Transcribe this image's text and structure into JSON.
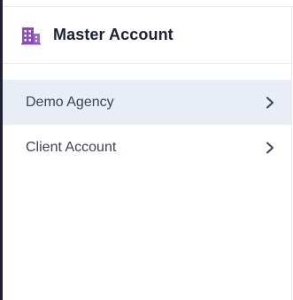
{
  "header": {
    "title": "Master Account",
    "icon": "building-icon",
    "icon_color": "#8b4bb8"
  },
  "menu": {
    "items": [
      {
        "label": "Demo Agency",
        "active": true,
        "icon": "chevron-right-icon"
      },
      {
        "label": "Client Account",
        "active": false,
        "icon": "chevron-right-icon"
      }
    ]
  },
  "colors": {
    "active_bg": "#e9eef6",
    "text": "#3d4355",
    "title": "#1e2035"
  }
}
